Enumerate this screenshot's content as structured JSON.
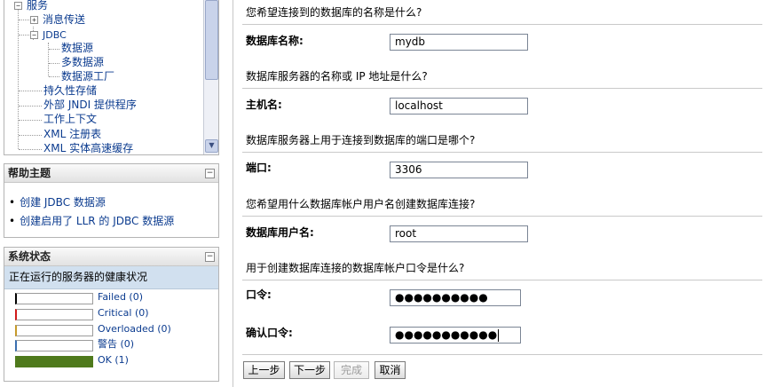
{
  "tree": {
    "items": [
      {
        "label": "服务",
        "expander": "−"
      },
      {
        "label": "消息传送",
        "expander": "+"
      },
      {
        "label": "JDBC",
        "expander": "−"
      },
      {
        "label": "数据源",
        "expander": ""
      },
      {
        "label": "多数据源",
        "expander": ""
      },
      {
        "label": "数据源工厂",
        "expander": ""
      },
      {
        "label": "持久性存储",
        "expander": ""
      },
      {
        "label": "外部 JNDI 提供程序",
        "expander": ""
      },
      {
        "label": "工作上下文",
        "expander": ""
      },
      {
        "label": "XML 注册表",
        "expander": ""
      },
      {
        "label": "XML 实体高速缓存",
        "expander": ""
      }
    ]
  },
  "help": {
    "title": "帮助主题",
    "minimize": "−",
    "links": [
      "创建 JDBC 数据源",
      "创建启用了 LLR 的 JDBC 数据源"
    ]
  },
  "status": {
    "title": "系统状态",
    "minimize": "−",
    "subtitle": "正在运行的服务器的健康状况",
    "rows": [
      {
        "label": "Failed (0)",
        "color": "#000000",
        "fill": 0
      },
      {
        "label": "Critical (0)",
        "color": "#d11a1a",
        "fill": 0
      },
      {
        "label": "Overloaded (0)",
        "color": "#c79a2a",
        "fill": 0
      },
      {
        "label": "警告 (0)",
        "color": "#3a6fb0",
        "fill": 0
      },
      {
        "label": "OK (1)",
        "color": "#4f7a1c",
        "fill": 1
      }
    ]
  },
  "form": {
    "q_dbname": "您希望连接到的数据库的名称是什么?",
    "label_dbname": "数据库名称:",
    "value_dbname": "mydb",
    "q_host": "数据库服务器的名称或 IP 地址是什么?",
    "label_host": "主机名:",
    "value_host": "localhost",
    "q_port": "数据库服务器上用于连接到数据库的端口是哪个?",
    "label_port": "端口:",
    "value_port": "3306",
    "q_user": "您希望用什么数据库帐户用户名创建数据库连接?",
    "label_user": "数据库用户名:",
    "value_user": "root",
    "q_password": "用于创建数据库连接的数据库帐户口令是什么?",
    "label_password": "口令:",
    "value_password": "●●●●●●●●●●",
    "label_confirm": "确认口令:",
    "value_confirm": "●●●●●●●●●●●"
  },
  "buttons": {
    "back": "上一步",
    "next": "下一步",
    "finish": "完成",
    "cancel": "取消"
  }
}
